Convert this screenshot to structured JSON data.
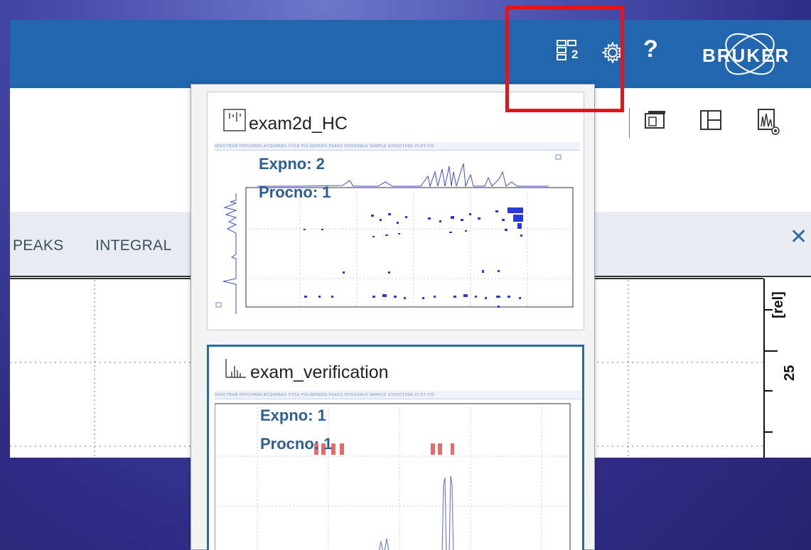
{
  "header": {
    "brand": "BRUKER",
    "layout_icon_badge": "2",
    "help_label": "?"
  },
  "tabs": [
    "PEAKS",
    "INTEGRAL"
  ],
  "close_label": "✕",
  "axis": {
    "unit_label": "[rel]",
    "tick_value": "25"
  },
  "popup": {
    "datasets": [
      {
        "name": "exam2d_HC",
        "type_icon": "2d-spectrum-icon",
        "expno_label": "Expno: 2",
        "procno_label": "Procno: 1"
      },
      {
        "name": "exam_verification",
        "type_icon": "1d-spectrum-icon",
        "expno_label": "Expno: 1",
        "procno_label": "Procno: 1"
      }
    ]
  },
  "colors": {
    "appbar": "#2166ae",
    "highlight": "#e5141b",
    "selected_border": "#2d6aa7"
  }
}
